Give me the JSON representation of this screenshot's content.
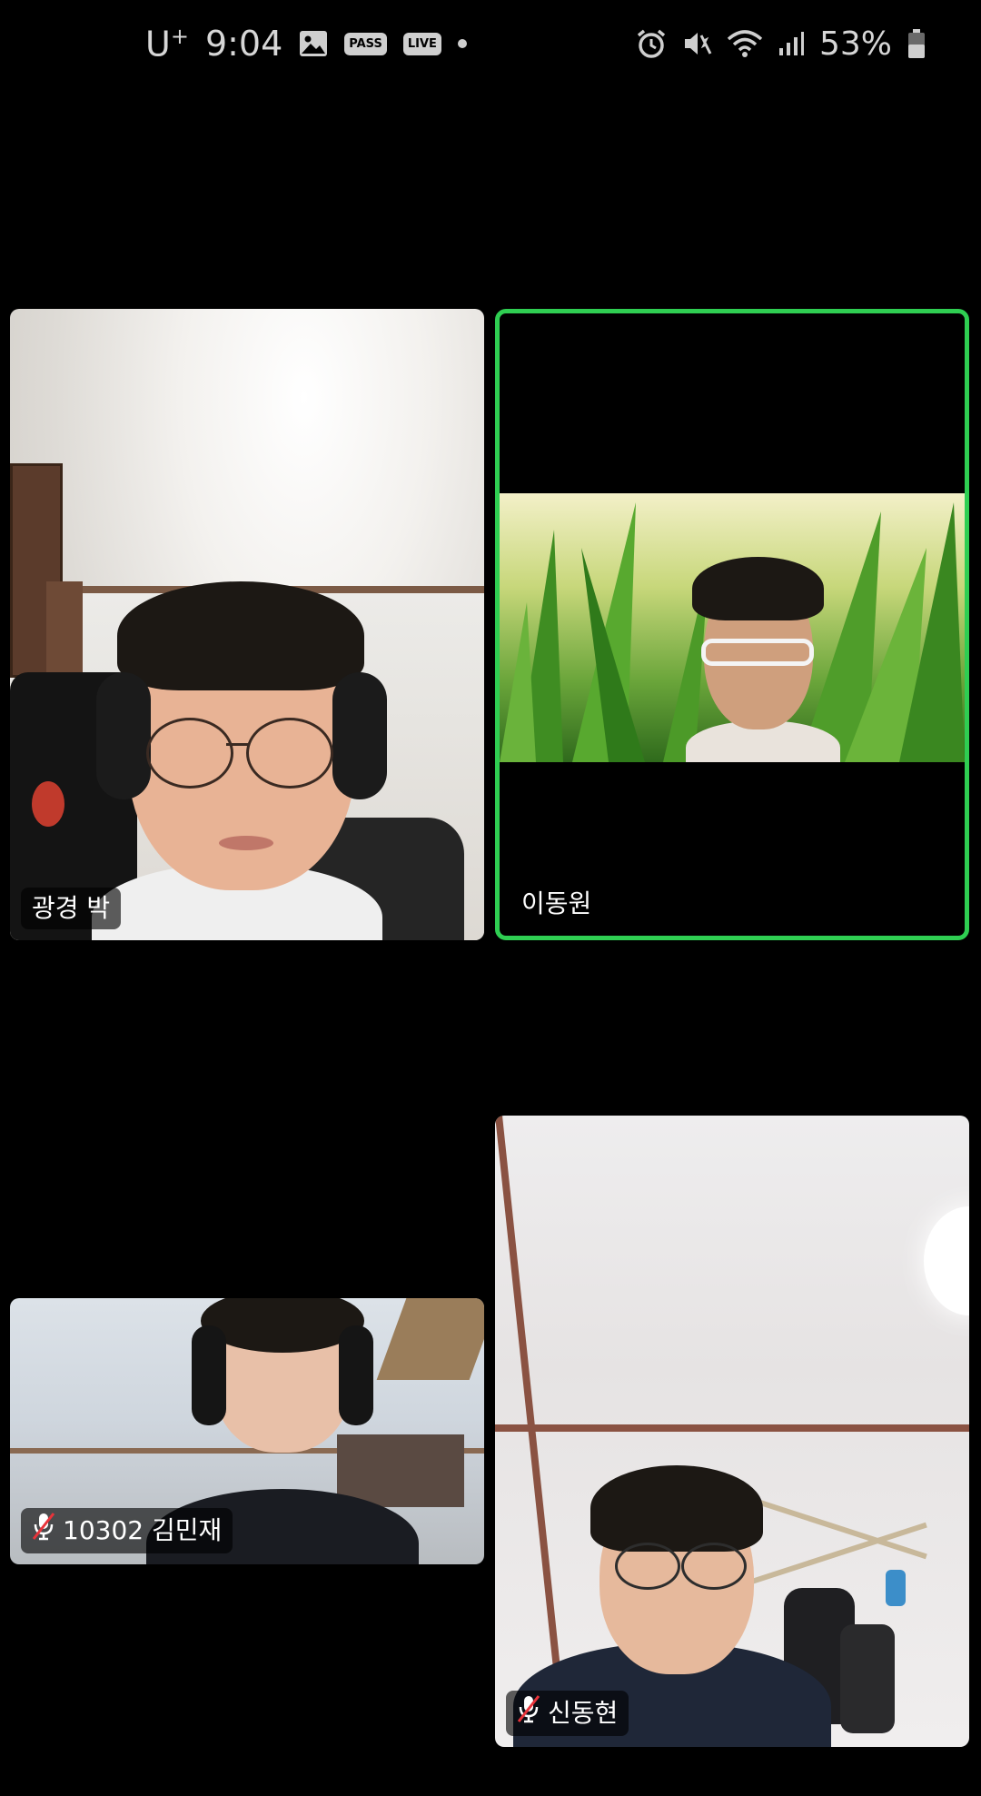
{
  "status_bar": {
    "carrier": "U",
    "carrier_suffix": "+",
    "time": "9:04",
    "notif_pass": "PASS",
    "notif_live": "LIVE",
    "battery": "53%",
    "icons": [
      "gallery-icon",
      "pass-icon",
      "live-icon",
      "alarm-icon",
      "mute-vibrate-icon",
      "wifi-icon",
      "signal-icon",
      "battery-icon"
    ]
  },
  "participants": [
    {
      "name": "광경 박",
      "muted": false,
      "active_speaker": false
    },
    {
      "name": "이동원",
      "muted": false,
      "active_speaker": true
    },
    {
      "name": "10302 김민재",
      "muted": true,
      "active_speaker": false
    },
    {
      "name": "신동현",
      "muted": true,
      "active_speaker": false
    }
  ],
  "colors": {
    "background": "#000000",
    "active_speaker_border": "#2fce52",
    "status_text": "#d6d6d6",
    "mute_slash": "#e8333a"
  }
}
